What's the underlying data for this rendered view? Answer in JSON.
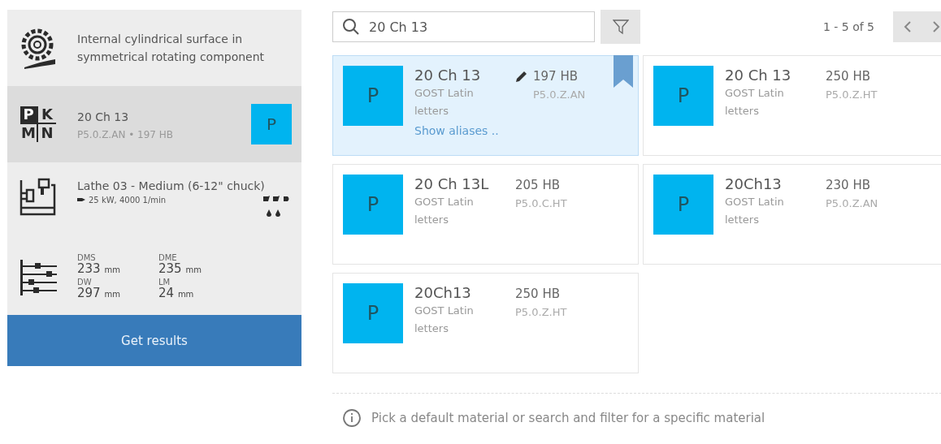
{
  "sidebar": {
    "items": [
      {
        "kind": "feature",
        "text": "Internal cylindrical surface in symmetrical rotating component",
        "selected": false
      },
      {
        "kind": "material",
        "iso_groups": [
          {
            "letter": "P",
            "selected": true
          },
          {
            "letter": "K",
            "selected": false
          },
          {
            "letter": "M",
            "selected": false
          },
          {
            "letter": "N",
            "selected": false
          }
        ],
        "title": "20 Ch 13",
        "subtitle": "P5.0.Z.AN • 197 HB",
        "group": "P",
        "selected": true
      },
      {
        "kind": "machine",
        "title": "Lathe 03 - Medium (6-12\" chuck)",
        "subtitle": "25 kW, 4000 1/min",
        "selected": false
      },
      {
        "kind": "dimensions",
        "selected": false,
        "values": [
          {
            "label": "DMS",
            "value": "233",
            "unit": "mm"
          },
          {
            "label": "DME",
            "value": "235",
            "unit": "mm"
          },
          {
            "label": "DW",
            "value": "297",
            "unit": "mm"
          },
          {
            "label": "LM",
            "value": "24",
            "unit": "mm"
          }
        ]
      }
    ],
    "button": "Get results"
  },
  "search": {
    "value": "20 Ch 13"
  },
  "pagination": {
    "text": "1 - 5 of 5"
  },
  "materials": [
    {
      "group": "P",
      "name": "20 Ch 13",
      "standard": "GOST Latin letters",
      "hardness": "197 HB",
      "code": "P5.0.Z.AN",
      "selected": true,
      "edited": true,
      "link": "Show aliases .."
    },
    {
      "group": "P",
      "name": "20 Ch 13",
      "standard": "GOST Latin letters",
      "hardness": "250 HB",
      "code": "P5.0.Z.HT",
      "selected": false,
      "edited": false
    },
    {
      "group": "P",
      "name": "20 Ch 13L",
      "standard": "GOST Latin letters",
      "hardness": "205 HB",
      "code": "P5.0.C.HT",
      "selected": false,
      "edited": false
    },
    {
      "group": "P",
      "name": "20Ch13",
      "standard": "GOST Latin letters",
      "hardness": "230 HB",
      "code": "P5.0.Z.AN",
      "selected": false,
      "edited": false
    },
    {
      "group": "P",
      "name": "20Ch13",
      "standard": "GOST Latin letters",
      "hardness": "250 HB",
      "code": "P5.0.Z.HT",
      "selected": false,
      "edited": false
    }
  ],
  "hint": "Pick a default material or search and filter for a specific material"
}
